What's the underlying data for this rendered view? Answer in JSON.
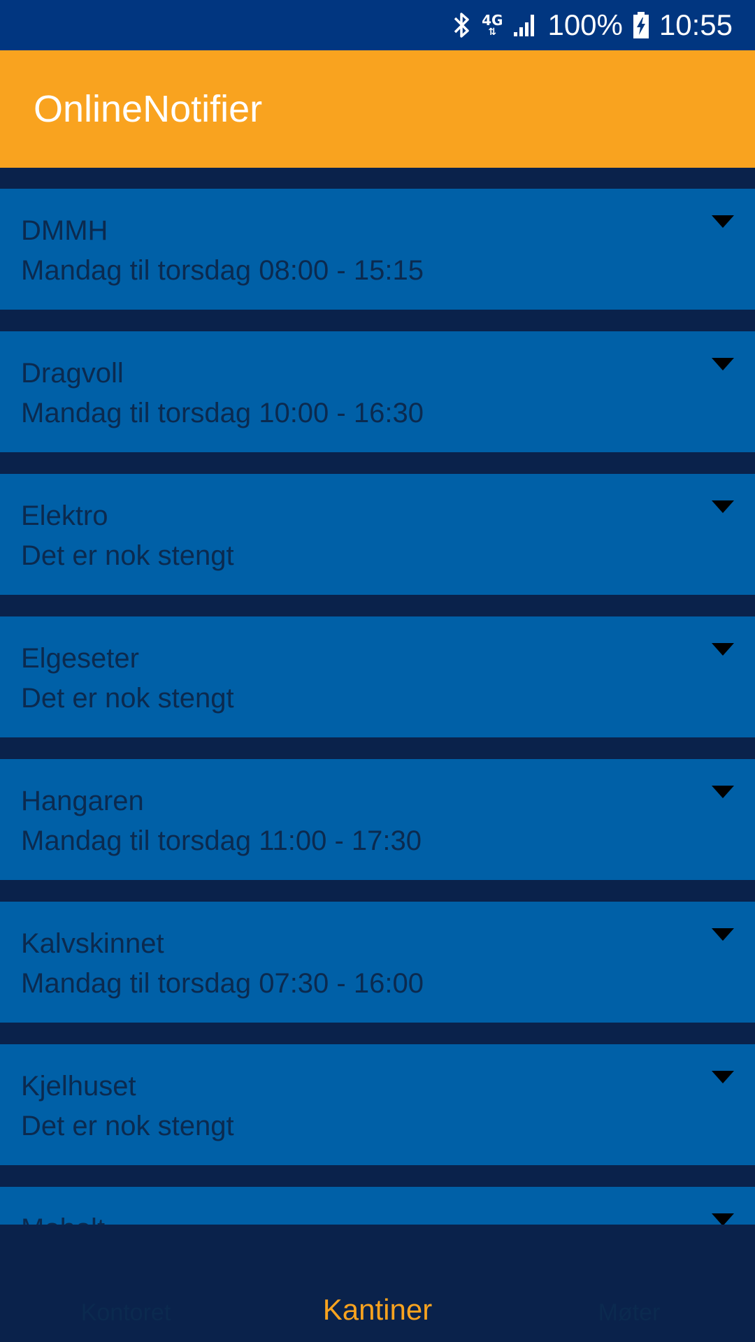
{
  "status_bar": {
    "network": "4G",
    "battery_percent": "100%",
    "time": "10:55",
    "icons": [
      "bluetooth-icon",
      "4g-icon",
      "signal-icon",
      "battery-charging-icon"
    ]
  },
  "app_bar": {
    "title": "OnlineNotifier"
  },
  "canteens": [
    {
      "name": "DMMH",
      "hours": "Mandag til torsdag 08:00 - 15:15"
    },
    {
      "name": "Dragvoll",
      "hours": "Mandag til torsdag 10:00 - 16:30"
    },
    {
      "name": "Elektro",
      "hours": "Det er nok stengt"
    },
    {
      "name": "Elgeseter",
      "hours": "Det er nok stengt"
    },
    {
      "name": "Hangaren",
      "hours": "Mandag til torsdag 11:00 - 17:30"
    },
    {
      "name": "Kalvskinnet",
      "hours": "Mandag til torsdag 07:30 - 16:00"
    },
    {
      "name": "Kjelhuset",
      "hours": "Det er nok stengt"
    },
    {
      "name": "Moholt",
      "hours": ""
    }
  ],
  "bottom_nav": {
    "items": [
      "Kontoret",
      "Kantiner",
      "Møter"
    ],
    "active": "Kantiner"
  },
  "colors": {
    "status_bar": "#013680",
    "app_bar": "#f9a31f",
    "background": "#0a224b",
    "card": "#0060a7",
    "text": "#0b2a4f",
    "active_tab": "#f9a31f"
  }
}
